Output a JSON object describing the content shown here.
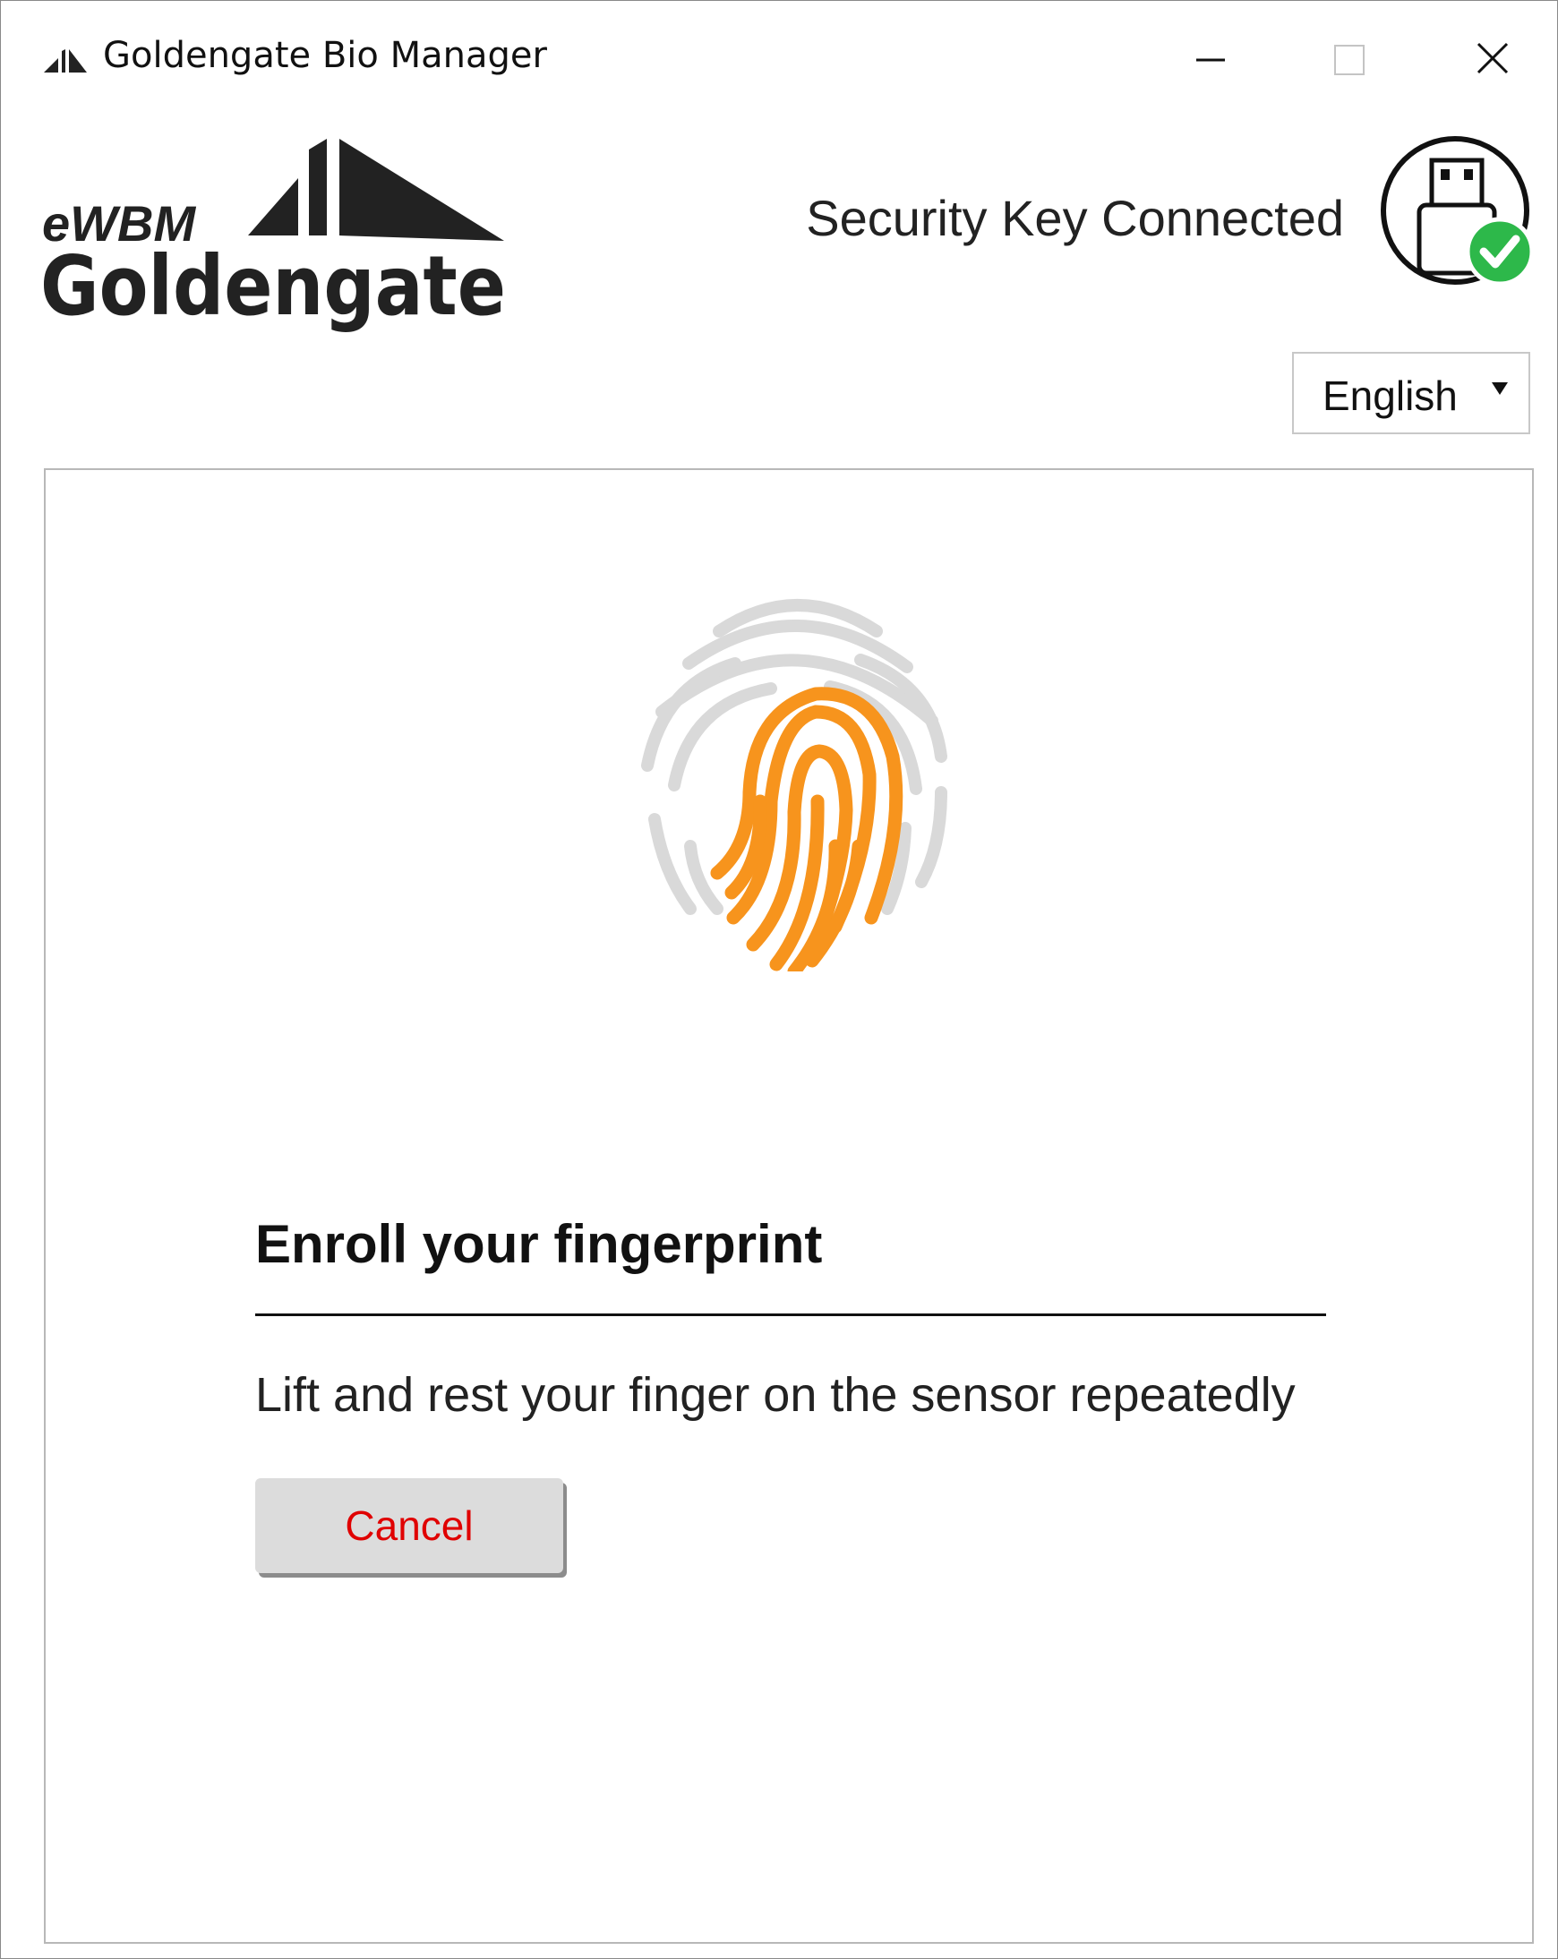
{
  "window": {
    "title": "Goldengate Bio Manager",
    "controls": [
      "minimize",
      "maximize",
      "close"
    ]
  },
  "header": {
    "logo_small": "eWBM",
    "logo_large": "Goldengate",
    "status_text": "Security Key Connected",
    "status_icon": "usb-key-connected-icon"
  },
  "language": {
    "selected": "English"
  },
  "enroll": {
    "heading": "Enroll your fingerprint",
    "instruction": "Lift and rest your finger on the sensor repeatedly",
    "cancel_label": "Cancel"
  },
  "colors": {
    "accent_orange": "#F7941D",
    "fingerprint_gray": "#D9D9D9",
    "cancel_text": "#E00000",
    "status_green": "#2DB84A"
  }
}
